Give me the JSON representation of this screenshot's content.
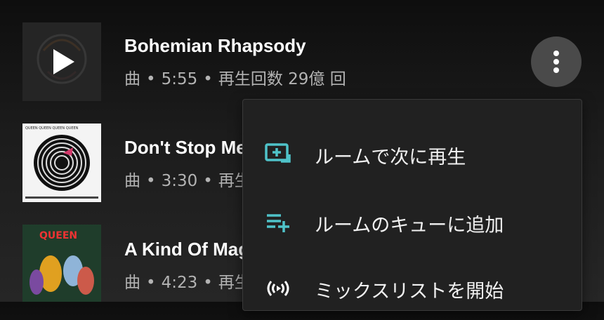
{
  "songs": [
    {
      "title": "Bohemian Rhapsody",
      "type": "曲",
      "duration": "5:55",
      "plays": "再生回数 29億 回",
      "art": "album-art-a-night-at-the-opera",
      "playing": true
    },
    {
      "title": "Don't Stop Me",
      "type": "曲",
      "duration": "3:30",
      "plays": "再生",
      "art": "album-art-jazz",
      "cover_text": "QUEEN QUEEN QUEEN QUEEN"
    },
    {
      "title": "A Kind Of Mag",
      "type": "曲",
      "duration": "4:23",
      "plays": "再生",
      "art": "album-art-a-kind-of-magic",
      "cover_text": "QUEEN"
    }
  ],
  "more_button": {
    "icon": "more-vert-icon"
  },
  "menu": {
    "items": [
      {
        "label": "ルームで次に再生",
        "icon": "cast-play-next-icon"
      },
      {
        "label": "ルームのキューに追加",
        "icon": "add-to-queue-icon"
      },
      {
        "label": "ミックスリストを開始",
        "icon": "radio-mix-icon"
      }
    ],
    "accent": "#4fc3c9"
  },
  "separator": "•"
}
